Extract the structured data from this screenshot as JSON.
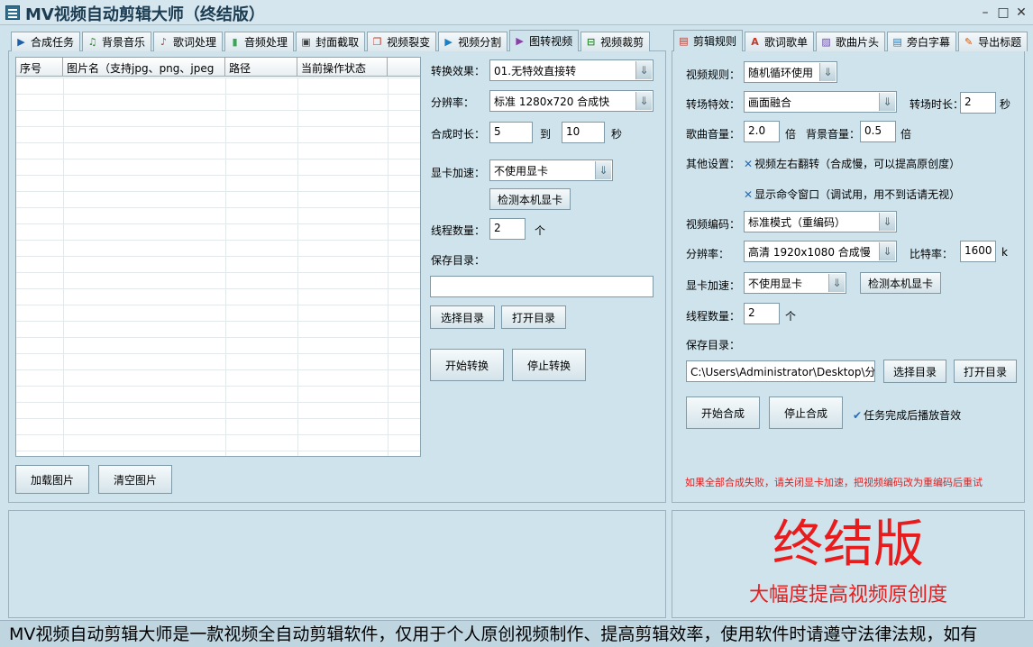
{
  "title": "MV视频自动剪辑大师（终结版）",
  "window_buttons": {
    "minimize": "–",
    "maximize": "□",
    "close": "✕"
  },
  "left_tabs": [
    {
      "label": "合成任务",
      "icon": "▶",
      "color": "#1f5fa8"
    },
    {
      "label": "背景音乐",
      "icon": "♫",
      "color": "#2a8a2a"
    },
    {
      "label": "歌词处理",
      "icon": "♪",
      "color": "#c0392b"
    },
    {
      "label": "音频处理",
      "icon": "▮",
      "color": "#3aa655"
    },
    {
      "label": "封面截取",
      "icon": "▣",
      "color": "#444"
    },
    {
      "label": "视频裂变",
      "icon": "❐",
      "color": "#c0392b"
    },
    {
      "label": "视频分割",
      "icon": "▶",
      "color": "#1f7fc0"
    },
    {
      "label": "图转视频",
      "icon": "▶",
      "color": "#8a3fa8"
    },
    {
      "label": "视频裁剪",
      "icon": "⊟",
      "color": "#2a8a2a"
    }
  ],
  "table": {
    "headers": [
      "序号",
      "图片名（支持jpg、png、jpeg",
      "路径",
      "当前操作状态"
    ]
  },
  "left_buttons": {
    "load": "加载图片",
    "clear": "清空图片"
  },
  "mid": {
    "effect_label": "转换效果：",
    "effect_value": "01.无特效直接转",
    "resolution_label": "分辨率：",
    "resolution_value": "标准 1280x720  合成快",
    "duration_label": "合成时长：",
    "duration_from": "5",
    "duration_to_label": "到",
    "duration_to": "10",
    "duration_unit": "秒",
    "gpu_label": "显卡加速：",
    "gpu_value": "不使用显卡",
    "detect_gpu": "检测本机显卡",
    "threads_label": "线程数量：",
    "threads_value": "2",
    "threads_unit": "个",
    "save_dir_label": "保存目录：",
    "save_dir_value": "",
    "choose_dir": "选择目录",
    "open_dir": "打开目录",
    "start": "开始转换",
    "stop": "停止转换"
  },
  "right_tabs": [
    {
      "label": "剪辑规则",
      "icon": "▤",
      "color": "#c0392b"
    },
    {
      "label": "歌词歌单",
      "icon": "A",
      "color": "#c0392b"
    },
    {
      "label": "歌曲片头",
      "icon": "▨",
      "color": "#6a4fa8"
    },
    {
      "label": "旁白字幕",
      "icon": "▤",
      "color": "#1f7fc0"
    },
    {
      "label": "导出标题",
      "icon": "✎",
      "color": "#d35400"
    }
  ],
  "right": {
    "rule_label": "视频规则：",
    "rule_value": "随机循环使用",
    "transition_label": "转场特效：",
    "transition_value": "画面融合",
    "transition_time_label": "转场时长：",
    "transition_time_value": "2",
    "transition_time_unit": "秒",
    "song_volume_label": "歌曲音量：",
    "song_volume_value": "2.0",
    "song_volume_unit": "倍",
    "bg_volume_label": "背景音量：",
    "bg_volume_value": "0.5",
    "bg_volume_unit": "倍",
    "other_label": "其他设置：",
    "flip_option": "视频左右翻转（合成慢，可以提高原创度）",
    "cmd_option": "显示命令窗口（调试用，用不到话请无视）",
    "encode_label": "视频编码：",
    "encode_value": "标准模式（重编码）",
    "resolution_label": "分辨率：",
    "resolution_value": "高清 1920x1080 合成慢",
    "bitrate_label": "比特率：",
    "bitrate_value": "1600",
    "bitrate_unit": "k",
    "gpu_label": "显卡加速：",
    "gpu_value": "不使用显卡",
    "detect_gpu": "检测本机显卡",
    "threads_label": "线程数量：",
    "threads_value": "2",
    "threads_unit": "个",
    "save_dir_label": "保存目录：",
    "save_dir_value": "C:\\Users\\Administrator\\Desktop\\分",
    "choose_dir": "选择目录",
    "open_dir": "打开目录",
    "start": "开始合成",
    "stop": "停止合成",
    "sound_option": "任务完成后播放音效",
    "warning": "如果全部合成失败，请关闭显卡加速，把视频编码改为重编码后重试"
  },
  "banner": {
    "big": "终结版",
    "sub": "大幅度提高视频原创度",
    "color": "#e81c1c"
  },
  "status_text": "MV视频自动剪辑大师是一款视频全自动剪辑软件，仅用于个人原创视频制作、提高剪辑效率，使用软件时请遵守法律法规，如有"
}
